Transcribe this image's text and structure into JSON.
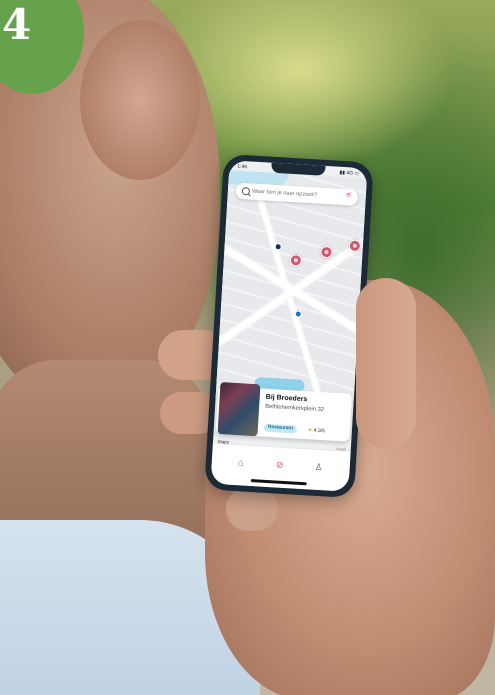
{
  "badge": {
    "number": "4"
  },
  "phone": {
    "status": {
      "time": "1:46",
      "icons": "▮▮ 4G ▭"
    },
    "search": {
      "placeholder": "Waar ben je naar opzoek?"
    },
    "place_card": {
      "name": "Bij Broeders",
      "address": "Bethlehemkerkplein 32",
      "category": "Restaurant",
      "rating": "4,3/5"
    },
    "map_credit": "Maps",
    "legal": "Legal",
    "tabs": [
      {
        "name": "home",
        "icon": "home-icon"
      },
      {
        "name": "explore",
        "icon": "compass-icon"
      },
      {
        "name": "profile",
        "icon": "profile-icon"
      }
    ]
  },
  "colors": {
    "badge": "#66a24b",
    "accent": "#e2478f",
    "pin": "#d2556e",
    "tag_bg": "#c5e8f5",
    "tag_text": "#1c6d94"
  }
}
